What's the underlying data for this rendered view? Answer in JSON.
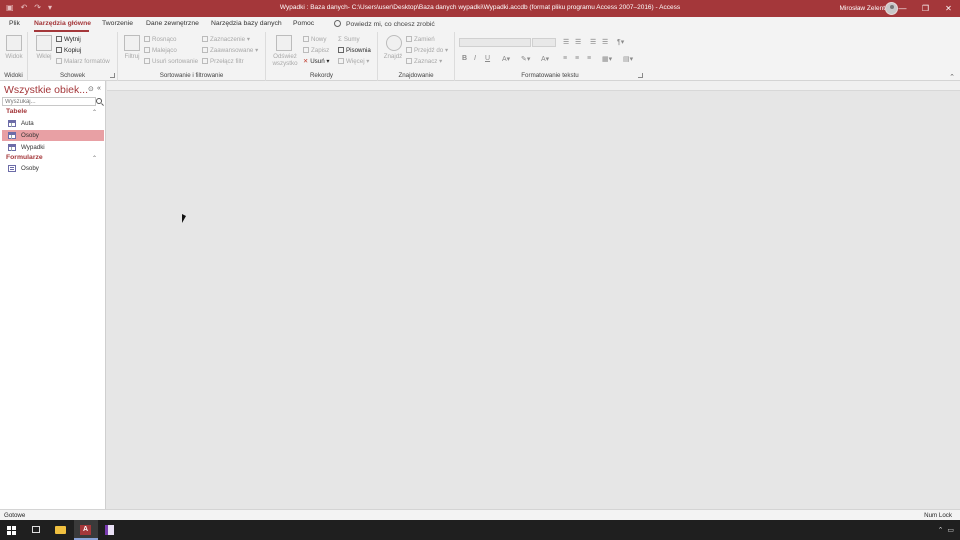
{
  "window": {
    "title": "Wypadki : Baza danych- C:\\Users\\user\\Desktop\\Baza danych wypadki\\Wypadki.accdb (format pliku programu Access 2007–2016)  -  Access",
    "user": "Mirosław Zelent"
  },
  "ribbon_tabs": [
    "Plik",
    "Narzędzia główne",
    "Tworzenie",
    "Dane zewnętrzne",
    "Narzędzia bazy danych",
    "Pomoc"
  ],
  "tell_me": "Powiedz mi, co chcesz zrobić",
  "ribbon": {
    "widoki": {
      "label": "Widoki",
      "view": "Widok"
    },
    "schowek": {
      "label": "Schowek",
      "paste": "Wklej",
      "cut": "Wytnij",
      "copy": "Kopiuj",
      "painter": "Malarz formatów"
    },
    "sort": {
      "label": "Sortowanie i filtrowanie",
      "filter": "Filtruj",
      "asc": "Rosnąco",
      "desc": "Malejąco",
      "remove_sort": "Usuń sortowanie",
      "selection": "Zaznaczenie",
      "advanced": "Zaawansowane",
      "toggle": "Przełącz filtr"
    },
    "records": {
      "label": "Rekordy",
      "refresh": "Odśwież wszystko",
      "new": "Nowy",
      "save": "Zapisz",
      "delete": "Usuń",
      "totals": "Sumy",
      "spelling": "Pisownia",
      "more": "Więcej"
    },
    "find": {
      "label": "Znajdowanie",
      "find": "Znajdź",
      "replace": "Zamień",
      "goto": "Przejdź do",
      "select": "Zaznacz"
    },
    "text": {
      "label": "Formatowanie tekstu",
      "bold": "B",
      "italic": "I",
      "underline": "U"
    }
  },
  "nav": {
    "title": "Wszystkie obiek...",
    "search_placeholder": "Wyszukaj...",
    "groups": [
      {
        "name": "Tabele",
        "items": [
          "Auta",
          "Osoby",
          "Wypadki"
        ]
      },
      {
        "name": "Formularze",
        "items": [
          "Osoby"
        ]
      }
    ]
  },
  "status": {
    "left": "Gotowe",
    "right": "Num Lock"
  },
  "colors": {
    "accent": "#a4373a",
    "selected": "#e8a0a4"
  }
}
